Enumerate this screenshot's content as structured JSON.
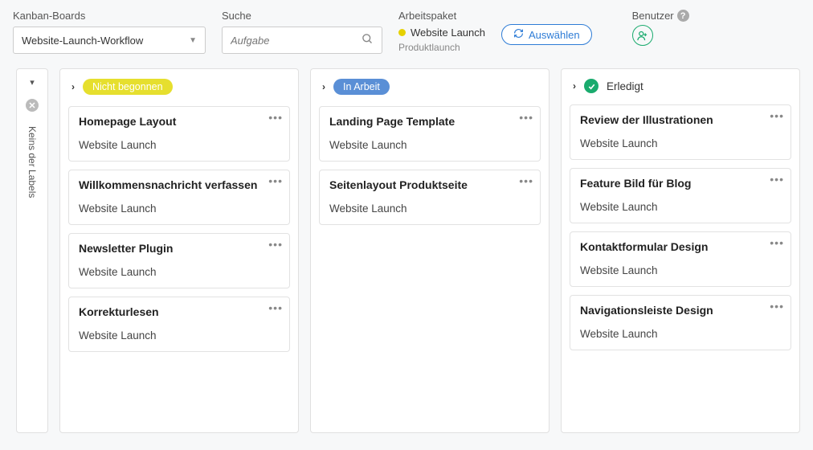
{
  "header": {
    "boards_label": "Kanban-Boards",
    "board_selected": "Website-Launch-Workflow",
    "search_label": "Suche",
    "search_placeholder": "Aufgabe",
    "arbeitspaket_label": "Arbeitspaket",
    "arbeitspaket_title": "Website Launch",
    "arbeitspaket_sub": "Produktlaunch",
    "select_btn": "Auswählen",
    "user_label": "Benutzer"
  },
  "side": {
    "label": "Keins der Labels"
  },
  "columns": [
    {
      "type": "pill",
      "pill_class": "pill-yellow",
      "label": "Nicht begonnen",
      "cards": [
        {
          "title": "Homepage Layout",
          "project": "Website Launch"
        },
        {
          "title": "Willkommensnachricht verfassen",
          "project": "Website Launch"
        },
        {
          "title": "Newsletter Plugin",
          "project": "Website Launch"
        },
        {
          "title": "Korrekturlesen",
          "project": "Website Launch"
        }
      ]
    },
    {
      "type": "pill",
      "pill_class": "pill-blue",
      "label": "In Arbeit",
      "cards": [
        {
          "title": "Landing Page Template",
          "project": "Website Launch"
        },
        {
          "title": "Seitenlayout Produktseite",
          "project": "Website Launch"
        }
      ]
    },
    {
      "type": "done",
      "label": "Erledigt",
      "cards": [
        {
          "title": "Review der Illustrationen",
          "project": "Website Launch"
        },
        {
          "title": "Feature Bild für Blog",
          "project": "Website Launch"
        },
        {
          "title": "Kontaktformular Design",
          "project": "Website Launch"
        },
        {
          "title": "Navigationsleiste Design",
          "project": "Website Launch"
        }
      ]
    }
  ]
}
